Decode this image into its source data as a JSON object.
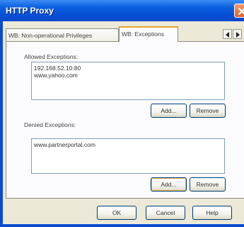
{
  "window": {
    "title": "HTTP Proxy"
  },
  "tabs": [
    {
      "label": "WB: Non-operational Privileges",
      "selected": false
    },
    {
      "label": "WB: Exceptions",
      "selected": true
    }
  ],
  "allowed": {
    "label": "Allowed Exceptions:",
    "items": [
      "192.168.52.10:80",
      "www.yahoo.com"
    ],
    "add_label": "Add...",
    "remove_label": "Remove"
  },
  "denied": {
    "label": "Denied Exceptions:",
    "items": [
      "www.partnerportal.com"
    ],
    "add_label": "Add...",
    "remove_label": "Remove"
  },
  "footer": {
    "ok_label": "OK",
    "cancel_label": "Cancel",
    "help_label": "Help"
  },
  "icons": {
    "close": "close-icon",
    "tab_left": "chevron-left-icon",
    "tab_right": "chevron-right-icon"
  },
  "colors": {
    "titlebar": "#0550d6",
    "dialog_bg": "#ece9d8",
    "button_border": "#003c74",
    "close_button": "#e15f2e"
  }
}
